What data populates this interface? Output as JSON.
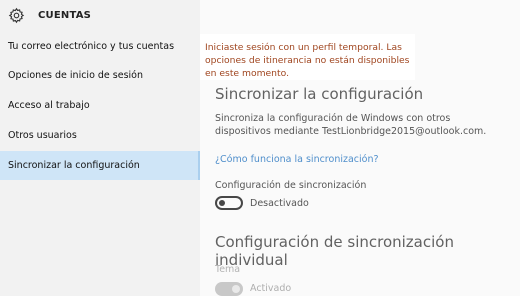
{
  "header": {
    "title": "CUENTAS",
    "icon": "gear-icon"
  },
  "sidebar": {
    "items": [
      {
        "label": "Tu correo electrónico y tus cuentas"
      },
      {
        "label": "Opciones de inicio de sesión"
      },
      {
        "label": "Acceso al trabajo"
      },
      {
        "label": "Otros usuarios"
      },
      {
        "label": "Sincronizar la configuración"
      }
    ],
    "active_index": 4
  },
  "banner": {
    "text": "Iniciaste sesión con un perfil temporal. Las opciones de itinerancia no están disponibles en este momento."
  },
  "main": {
    "section_title": "Sincronizar la configuración",
    "description": "Sincroniza la configuración de Windows con otros dispositivos mediante TestLionbridge2015@outlook.com.",
    "link": "¿Cómo funciona la sincronización?",
    "sync_label": "Configuración de sincronización",
    "sync_state": "Desactivado",
    "individual_title": "Configuración de sincronización individual",
    "theme_label": "Tema",
    "theme_state": "Activado"
  },
  "colors": {
    "sidebar_bg": "#f2f2f2",
    "active_bg": "#cfe5f7",
    "banner_text": "#a04620",
    "link": "#1a6fc0"
  }
}
